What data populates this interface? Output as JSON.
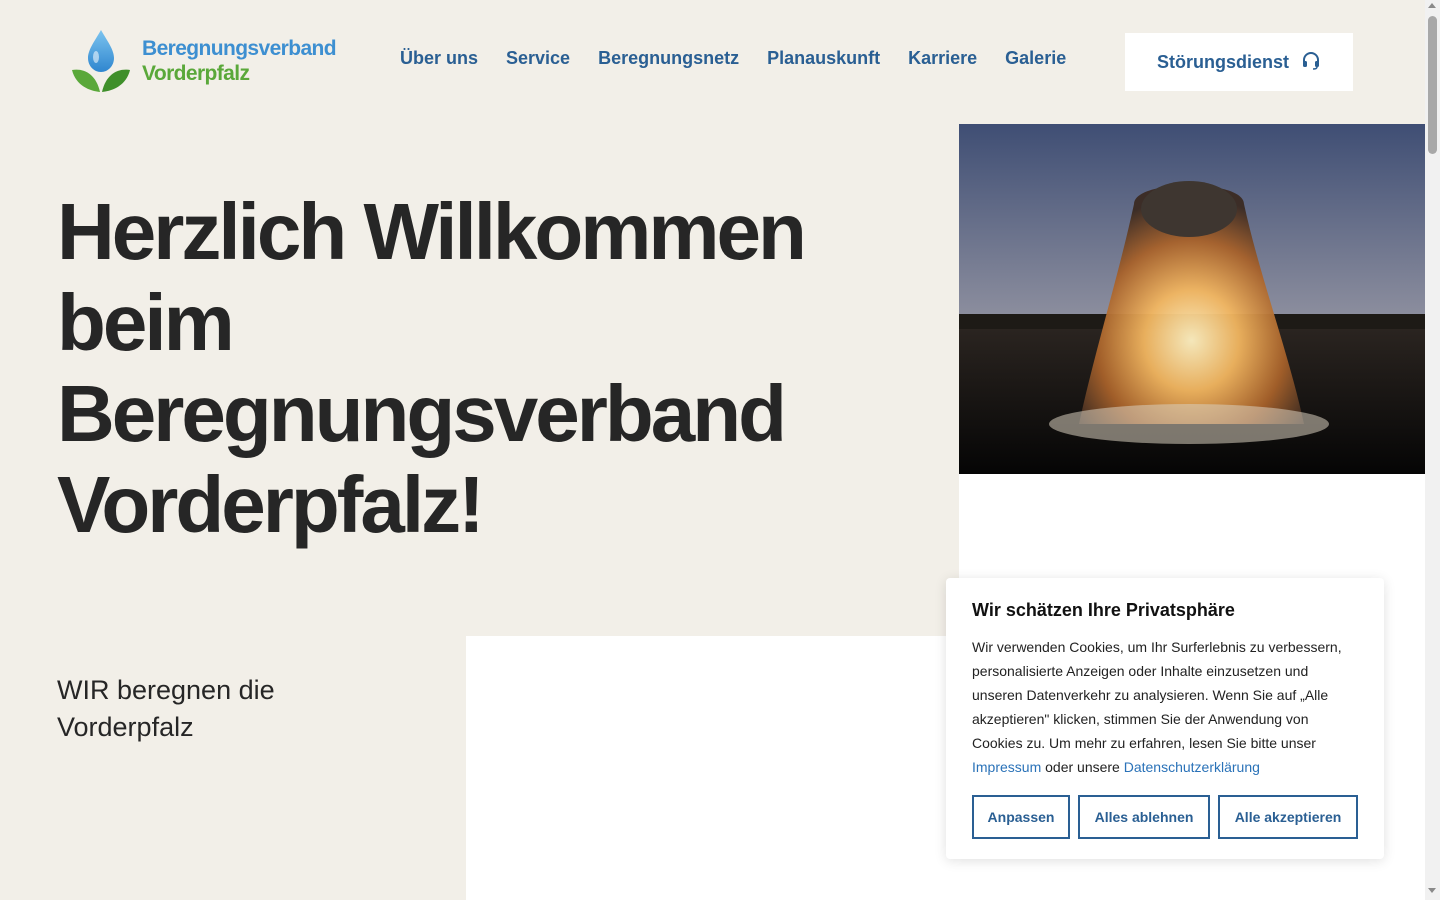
{
  "logo": {
    "line1": "Beregnungsverband",
    "line2": "Vorderpfalz",
    "icon": "water-drop-leaves-icon"
  },
  "nav": {
    "items": [
      {
        "label": "Über uns"
      },
      {
        "label": "Service"
      },
      {
        "label": "Beregnungsnetz"
      },
      {
        "label": "Planauskunft"
      },
      {
        "label": "Karriere"
      },
      {
        "label": "Galerie"
      }
    ],
    "stoerung": {
      "label": "Störungsdienst",
      "icon": "headset-icon"
    }
  },
  "hero": {
    "title": "Herzlich Willkommen beim Beregnungsverband Vorderpfalz!",
    "image": "fountain-sunset-photo",
    "tagline": "WIR beregnen die Vorderpfalz"
  },
  "cookie": {
    "title": "Wir schätzen Ihre Privatsphäre",
    "text": "Wir verwenden Cookies, um Ihr Surferlebnis zu verbessern, personalisierte Anzeigen oder Inhalte einzusetzen und unseren Datenverkehr zu analysieren. Wenn Sie auf „Alle akzeptieren\" klicken, stimmen Sie der Anwendung von Cookies zu. Um mehr zu erfahren, lesen Sie bitte unser",
    "link_impressum": "Impressum",
    "connector": "oder unsere",
    "link_datenschutz": "Datenschutzerklärung",
    "buttons": {
      "customize": "Anpassen",
      "reject": "Alles ablehnen",
      "accept": "Alle akzeptieren"
    }
  },
  "colors": {
    "background": "#f2efe8",
    "nav_blue": "#2a5f93",
    "logo_blue": "#3d8fd1",
    "logo_green": "#5aa83a",
    "text_dark": "#262626"
  }
}
